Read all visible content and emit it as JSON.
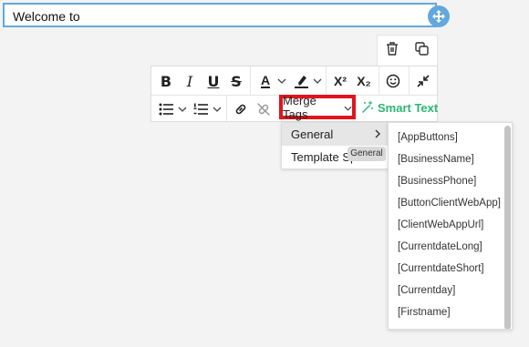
{
  "text_block": {
    "content": "Welcome to"
  },
  "block_actions": {
    "delete_icon": "trash-icon",
    "duplicate_icon": "duplicate-icon"
  },
  "toolbar": {
    "bold": "B",
    "italic": "I",
    "underline": "U",
    "strikethrough": "S",
    "font_color": "A",
    "superscript": "X²",
    "subscript": "X₂",
    "merge_tags_label": "Merge Tags",
    "smart_text_label": "Smart Text",
    "accent_color": "#2bb673",
    "highlight_border": "#e1141b"
  },
  "merge_menu": {
    "items": [
      {
        "label": "General"
      },
      {
        "label": "Template Spe"
      }
    ],
    "tooltip": "General"
  },
  "merge_tags": [
    "[AppButtons]",
    "[BusinessName]",
    "[BusinessPhone]",
    "[ButtonClientWebApp]",
    "[ClientWebAppUrl]",
    "[CurrentdateLong]",
    "[CurrentdateShort]",
    "[Currentday]",
    "[Firstname]"
  ]
}
